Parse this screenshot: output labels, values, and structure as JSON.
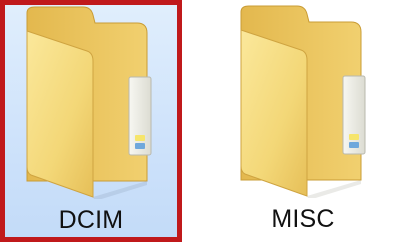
{
  "folders": [
    {
      "name": "DCIM",
      "selected": true,
      "icon": "folder-icon"
    },
    {
      "name": "MISC",
      "selected": false,
      "icon": "folder-icon"
    }
  ],
  "colors": {
    "selection_fill": "#cfe3fb",
    "selection_border": "#c0191b",
    "folder_front": "#f6dc7a",
    "folder_back": "#e9c35a",
    "label_text": "#111111"
  }
}
